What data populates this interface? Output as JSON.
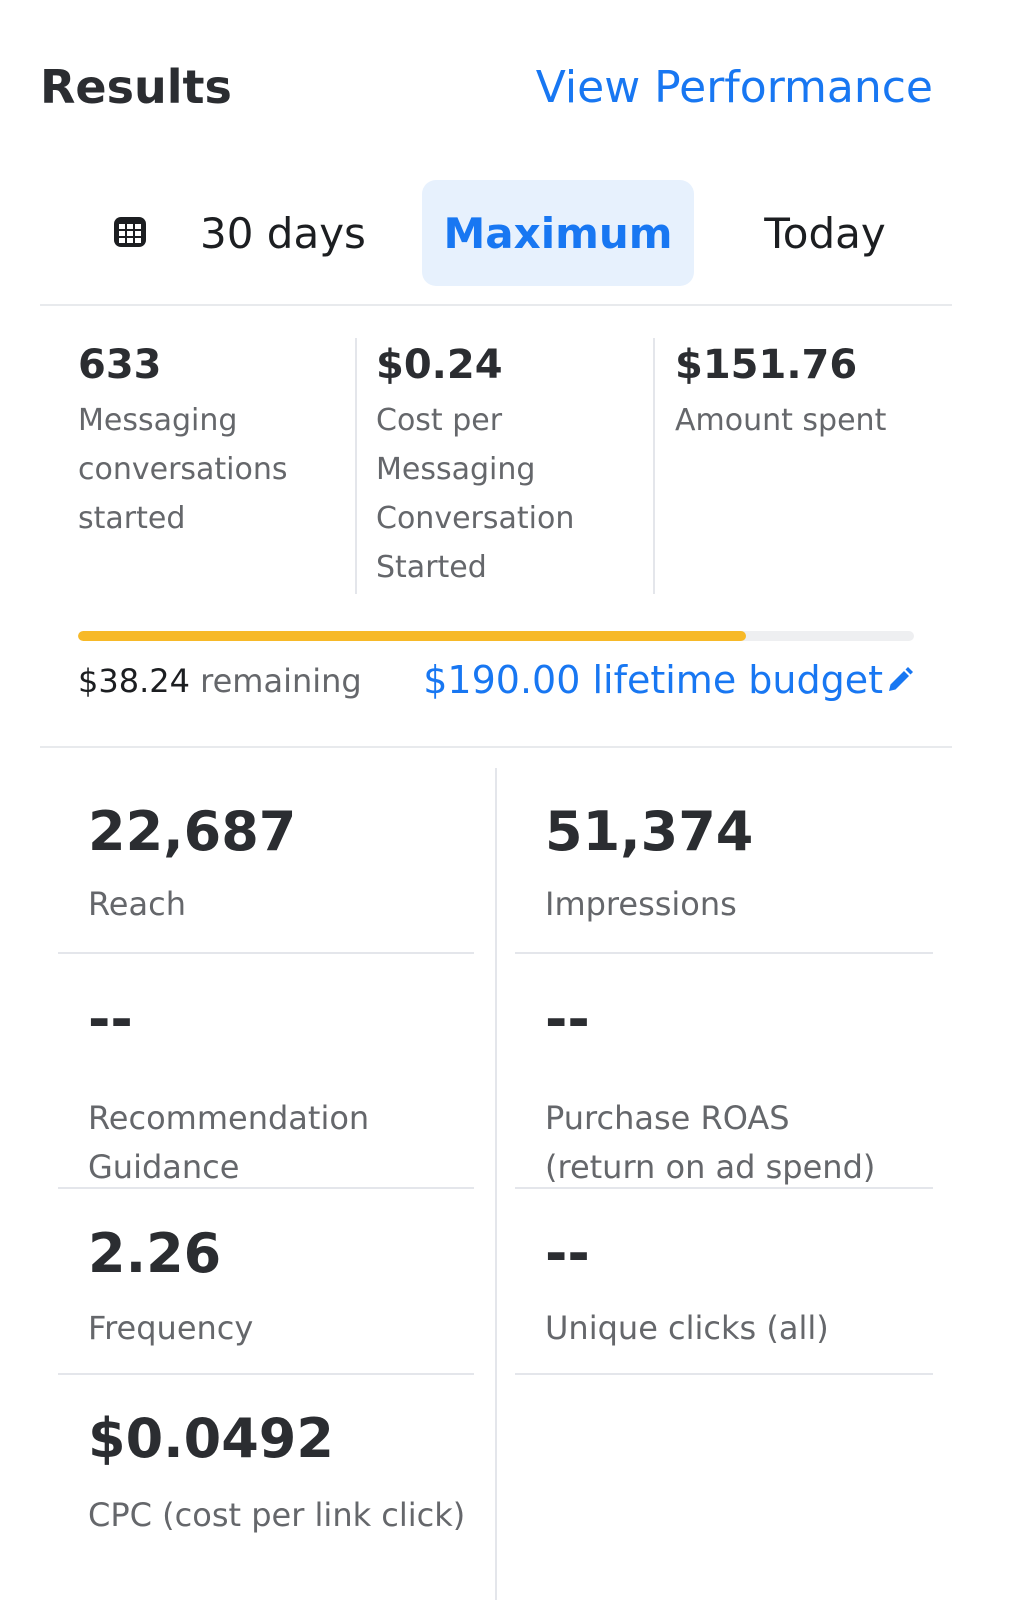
{
  "header": {
    "title": "Results",
    "view_performance_label": "View Performance"
  },
  "date_range": {
    "icon": "calendar-icon",
    "tabs": [
      {
        "label": "30 days",
        "selected": false
      },
      {
        "label": "Maximum",
        "selected": true
      },
      {
        "label": "Today",
        "selected": false
      }
    ]
  },
  "kpis": [
    {
      "value": "633",
      "label": "Messaging conversations started"
    },
    {
      "value": "$0.24",
      "label": "Cost per Messaging Conversation Started"
    },
    {
      "value": "$151.76",
      "label": "Amount spent"
    }
  ],
  "budget": {
    "remaining_amount": "$38.24",
    "remaining_suffix": "remaining",
    "lifetime_label": "$190.00 lifetime budget",
    "edit_icon": "pencil-icon",
    "spent_fraction": 0.799
  },
  "metrics": {
    "left": [
      {
        "value": "22,687",
        "label": "Reach"
      },
      {
        "value": "--",
        "label": "Recommendation Guidance"
      },
      {
        "value": "2.26",
        "label": "Frequency"
      },
      {
        "value": "$0.0492",
        "label": "CPC (cost per link click)"
      }
    ],
    "right": [
      {
        "value": "51,374",
        "label": "Impressions"
      },
      {
        "value": "--",
        "label": "Purchase ROAS (return on ad spend)"
      },
      {
        "value": "--",
        "label": "Unique clicks (all)"
      }
    ]
  },
  "colors": {
    "accent": "#1877f2",
    "selected_tab_bg": "#e7f1fd",
    "progress": "#f7b928"
  }
}
